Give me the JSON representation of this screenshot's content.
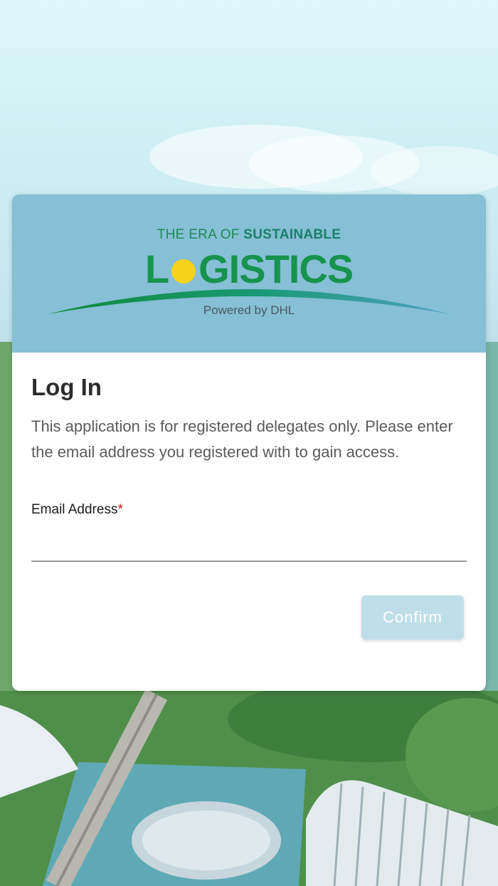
{
  "header": {
    "tagline_prefix": "THE ERA OF ",
    "tagline_bold": "SUSTAINABLE",
    "logo_word": "LOGISTICS",
    "logo_word_rest": "GISTICS",
    "logo_letter_l": "L",
    "powered_by": "Powered by DHL"
  },
  "login": {
    "title": "Log In",
    "description": "This application is for registered delegates only. Please enter the email address you registered with to gain access.",
    "email_label": "Email Address",
    "required_marker": "*",
    "email_value": "",
    "email_placeholder": "",
    "confirm_label": "Confirm"
  },
  "colors": {
    "header_bg": "#86bfd6",
    "logo_green": "#16934d",
    "logo_sun": "#f7d21a",
    "confirm_bg": "#bedfe8",
    "required": "#c01818"
  }
}
